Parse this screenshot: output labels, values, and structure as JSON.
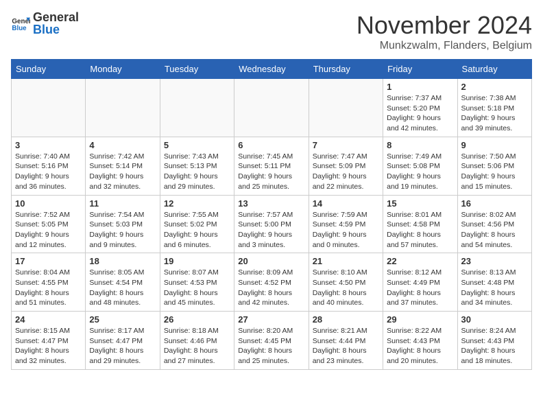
{
  "logo": {
    "general": "General",
    "blue": "Blue"
  },
  "title": "November 2024",
  "location": "Munkzwalm, Flanders, Belgium",
  "days_header": [
    "Sunday",
    "Monday",
    "Tuesday",
    "Wednesday",
    "Thursday",
    "Friday",
    "Saturday"
  ],
  "weeks": [
    [
      {
        "day": "",
        "info": ""
      },
      {
        "day": "",
        "info": ""
      },
      {
        "day": "",
        "info": ""
      },
      {
        "day": "",
        "info": ""
      },
      {
        "day": "",
        "info": ""
      },
      {
        "day": "1",
        "info": "Sunrise: 7:37 AM\nSunset: 5:20 PM\nDaylight: 9 hours and 42 minutes."
      },
      {
        "day": "2",
        "info": "Sunrise: 7:38 AM\nSunset: 5:18 PM\nDaylight: 9 hours and 39 minutes."
      }
    ],
    [
      {
        "day": "3",
        "info": "Sunrise: 7:40 AM\nSunset: 5:16 PM\nDaylight: 9 hours and 36 minutes."
      },
      {
        "day": "4",
        "info": "Sunrise: 7:42 AM\nSunset: 5:14 PM\nDaylight: 9 hours and 32 minutes."
      },
      {
        "day": "5",
        "info": "Sunrise: 7:43 AM\nSunset: 5:13 PM\nDaylight: 9 hours and 29 minutes."
      },
      {
        "day": "6",
        "info": "Sunrise: 7:45 AM\nSunset: 5:11 PM\nDaylight: 9 hours and 25 minutes."
      },
      {
        "day": "7",
        "info": "Sunrise: 7:47 AM\nSunset: 5:09 PM\nDaylight: 9 hours and 22 minutes."
      },
      {
        "day": "8",
        "info": "Sunrise: 7:49 AM\nSunset: 5:08 PM\nDaylight: 9 hours and 19 minutes."
      },
      {
        "day": "9",
        "info": "Sunrise: 7:50 AM\nSunset: 5:06 PM\nDaylight: 9 hours and 15 minutes."
      }
    ],
    [
      {
        "day": "10",
        "info": "Sunrise: 7:52 AM\nSunset: 5:05 PM\nDaylight: 9 hours and 12 minutes."
      },
      {
        "day": "11",
        "info": "Sunrise: 7:54 AM\nSunset: 5:03 PM\nDaylight: 9 hours and 9 minutes."
      },
      {
        "day": "12",
        "info": "Sunrise: 7:55 AM\nSunset: 5:02 PM\nDaylight: 9 hours and 6 minutes."
      },
      {
        "day": "13",
        "info": "Sunrise: 7:57 AM\nSunset: 5:00 PM\nDaylight: 9 hours and 3 minutes."
      },
      {
        "day": "14",
        "info": "Sunrise: 7:59 AM\nSunset: 4:59 PM\nDaylight: 9 hours and 0 minutes."
      },
      {
        "day": "15",
        "info": "Sunrise: 8:01 AM\nSunset: 4:58 PM\nDaylight: 8 hours and 57 minutes."
      },
      {
        "day": "16",
        "info": "Sunrise: 8:02 AM\nSunset: 4:56 PM\nDaylight: 8 hours and 54 minutes."
      }
    ],
    [
      {
        "day": "17",
        "info": "Sunrise: 8:04 AM\nSunset: 4:55 PM\nDaylight: 8 hours and 51 minutes."
      },
      {
        "day": "18",
        "info": "Sunrise: 8:05 AM\nSunset: 4:54 PM\nDaylight: 8 hours and 48 minutes."
      },
      {
        "day": "19",
        "info": "Sunrise: 8:07 AM\nSunset: 4:53 PM\nDaylight: 8 hours and 45 minutes."
      },
      {
        "day": "20",
        "info": "Sunrise: 8:09 AM\nSunset: 4:52 PM\nDaylight: 8 hours and 42 minutes."
      },
      {
        "day": "21",
        "info": "Sunrise: 8:10 AM\nSunset: 4:50 PM\nDaylight: 8 hours and 40 minutes."
      },
      {
        "day": "22",
        "info": "Sunrise: 8:12 AM\nSunset: 4:49 PM\nDaylight: 8 hours and 37 minutes."
      },
      {
        "day": "23",
        "info": "Sunrise: 8:13 AM\nSunset: 4:48 PM\nDaylight: 8 hours and 34 minutes."
      }
    ],
    [
      {
        "day": "24",
        "info": "Sunrise: 8:15 AM\nSunset: 4:47 PM\nDaylight: 8 hours and 32 minutes."
      },
      {
        "day": "25",
        "info": "Sunrise: 8:17 AM\nSunset: 4:47 PM\nDaylight: 8 hours and 29 minutes."
      },
      {
        "day": "26",
        "info": "Sunrise: 8:18 AM\nSunset: 4:46 PM\nDaylight: 8 hours and 27 minutes."
      },
      {
        "day": "27",
        "info": "Sunrise: 8:20 AM\nSunset: 4:45 PM\nDaylight: 8 hours and 25 minutes."
      },
      {
        "day": "28",
        "info": "Sunrise: 8:21 AM\nSunset: 4:44 PM\nDaylight: 8 hours and 23 minutes."
      },
      {
        "day": "29",
        "info": "Sunrise: 8:22 AM\nSunset: 4:43 PM\nDaylight: 8 hours and 20 minutes."
      },
      {
        "day": "30",
        "info": "Sunrise: 8:24 AM\nSunset: 4:43 PM\nDaylight: 8 hours and 18 minutes."
      }
    ]
  ]
}
